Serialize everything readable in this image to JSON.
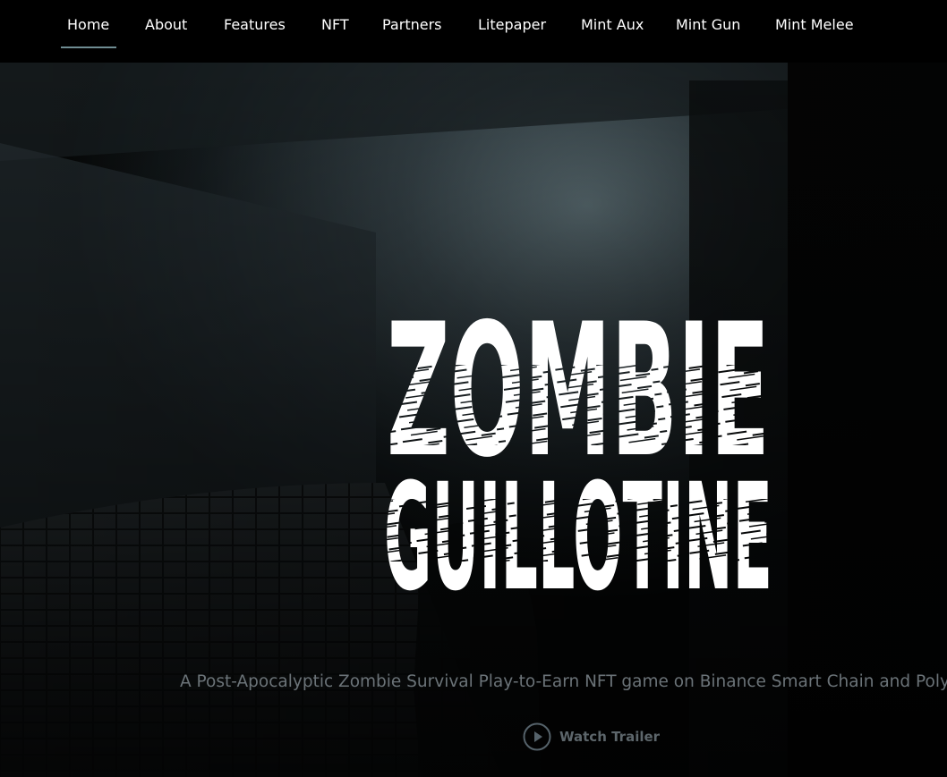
{
  "nav": {
    "items": [
      {
        "label": "Home",
        "active": true
      },
      {
        "label": "About"
      },
      {
        "label": "Features"
      },
      {
        "label": "NFT"
      },
      {
        "label": "Partners"
      },
      {
        "label": "Litepaper"
      },
      {
        "label": "Mint Aux"
      },
      {
        "label": "Mint Gun"
      },
      {
        "label": "Mint Melee"
      }
    ],
    "active_color": "#6f8c92"
  },
  "hero": {
    "logo_line1": "ZOMBIE",
    "logo_line2": "GUILLOTINE",
    "tagline": "A Post-Apocalyptic Zombie Survival Play-to-Earn NFT game on Binance Smart Chain and Polygon",
    "trailer_label": "Watch Trailer",
    "trailer_icon": "play-circle-icon"
  }
}
